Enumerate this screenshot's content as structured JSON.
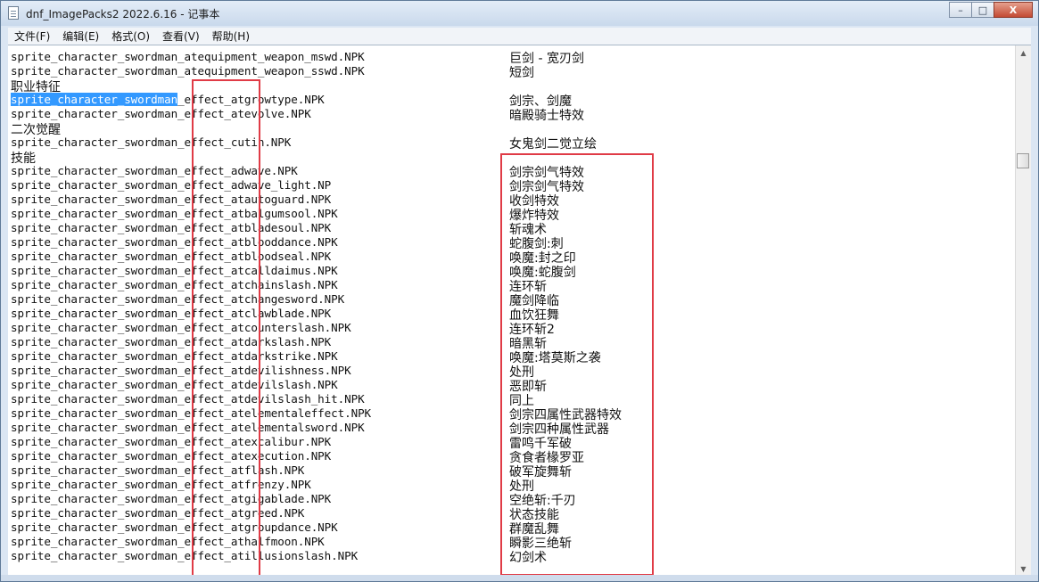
{
  "window": {
    "title": "dnf_ImagePacks2 2022.6.16 - 记事本",
    "caption": {
      "minimize": "–",
      "maximize": "□",
      "close": "X"
    }
  },
  "menu": [
    "文件(F)",
    "编辑(E)",
    "格式(O)",
    "查看(V)",
    "帮助(H)"
  ],
  "editor": {
    "lines": [
      {
        "a": "sprite_character_swordman_atequipment_weapon_mswd.NPK",
        "b": "巨剑 - 宽刃剑"
      },
      {
        "a": "sprite_character_swordman_atequipment_weapon_sswd.NPK",
        "b": "短剑"
      },
      {
        "h": "职业特征"
      },
      {
        "sel": "sprite_character_swordman",
        "a": "_effect_atgrowtype.NPK",
        "b": "剑宗、剑魔"
      },
      {
        "a": "sprite_character_swordman_effect_atevolve.NPK",
        "b": "暗殿骑士特效"
      },
      {
        "h": "二次觉醒"
      },
      {
        "a": "sprite_character_swordman_effect_cutin.NPK",
        "b": "女鬼剑二觉立绘"
      },
      {
        "h": "技能"
      },
      {
        "a": "sprite_character_swordman_effect_adwave.NPK",
        "b": "剑宗剑气特效"
      },
      {
        "a": "sprite_character_swordman_effect_adwave_light.NP",
        "b": "剑宗剑气特效"
      },
      {
        "a": "sprite_character_swordman_effect_atautoguard.NPK",
        "b": "收剑特效"
      },
      {
        "a": "sprite_character_swordman_effect_atbalgumsool.NPK",
        "b": "爆炸特效"
      },
      {
        "a": "sprite_character_swordman_effect_atbladesoul.NPK",
        "b": "斩魂术"
      },
      {
        "a": "sprite_character_swordman_effect_atblooddance.NPK",
        "b": "蛇腹剑:刺"
      },
      {
        "a": "sprite_character_swordman_effect_atbloodseal.NPK",
        "b": "唤魔:封之印"
      },
      {
        "a": "sprite_character_swordman_effect_atcalldaimus.NPK",
        "b": "唤魔:蛇腹剑"
      },
      {
        "a": "sprite_character_swordman_effect_atchainslash.NPK",
        "b": "连环斩"
      },
      {
        "a": "sprite_character_swordman_effect_atchangesword.NPK",
        "b": "魔剑降临"
      },
      {
        "a": "sprite_character_swordman_effect_atclawblade.NPK",
        "b": "血饮狂舞"
      },
      {
        "a": "sprite_character_swordman_effect_atcounterslash.NPK",
        "b": "连环斩2"
      },
      {
        "a": "sprite_character_swordman_effect_atdarkslash.NPK",
        "b": "暗黑斩"
      },
      {
        "a": "sprite_character_swordman_effect_atdarkstrike.NPK",
        "b": "唤魔:塔莫斯之袭"
      },
      {
        "a": "sprite_character_swordman_effect_atdevilishness.NPK",
        "b": "处刑"
      },
      {
        "a": "sprite_character_swordman_effect_atdevilslash.NPK",
        "b": "恶即斩"
      },
      {
        "a": "sprite_character_swordman_effect_atdevilslash_hit.NPK",
        "b": "同上"
      },
      {
        "a": "sprite_character_swordman_effect_atelementaleffect.NPK",
        "b": "剑宗四属性武器特效"
      },
      {
        "a": "sprite_character_swordman_effect_atelementalsword.NPK",
        "b": "剑宗四种属性武器"
      },
      {
        "a": "sprite_character_swordman_effect_atexcalibur.NPK",
        "b": "雷鸣千军破"
      },
      {
        "a": "sprite_character_swordman_effect_atexecution.NPK",
        "b": "贪食者椽罗亚"
      },
      {
        "a": "sprite_character_swordman_effect_atflash.NPK",
        "b": "破军旋舞斩"
      },
      {
        "a": "sprite_character_swordman_effect_atfrenzy.NPK",
        "b": "处刑"
      },
      {
        "a": "sprite_character_swordman_effect_atgigablade.NPK",
        "b": "空绝斩:千刃"
      },
      {
        "a": "sprite_character_swordman_effect_atgreed.NPK",
        "b": "状态技能"
      },
      {
        "a": "sprite_character_swordman_effect_atgroupdance.NPK",
        "b": "群魔乱舞"
      },
      {
        "a": "sprite_character_swordman_effect_athalfmoon.NPK",
        "b": "瞬影三绝斩"
      },
      {
        "a": "sprite_character_swordman_effect_atillusionslash.NPK",
        "b": "幻剑术"
      }
    ]
  },
  "scrollbar": {
    "up": "▲",
    "down": "▼",
    "position": 0.19
  },
  "colors": {
    "highlight": "#e03b46",
    "selection": "#3399ff"
  }
}
